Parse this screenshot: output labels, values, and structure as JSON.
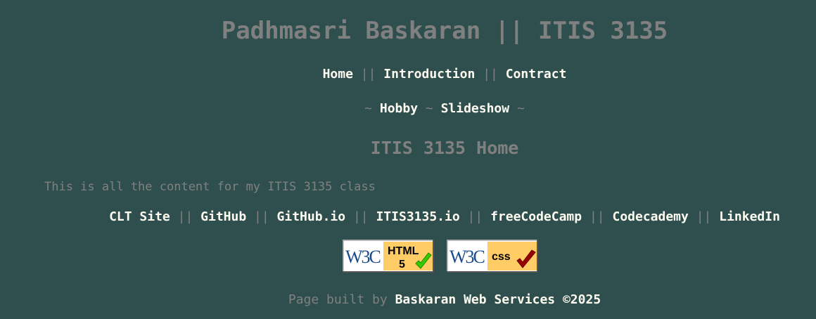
{
  "header": {
    "title": "Padhmasri Baskaran || ITIS 3135"
  },
  "nav_primary": {
    "items": [
      "Home",
      "Introduction",
      "Contract"
    ],
    "separator": "||"
  },
  "nav_secondary": {
    "items": [
      "Hobby",
      "Slideshow"
    ],
    "separator": "~"
  },
  "main": {
    "heading": "ITIS 3135 Home",
    "intro": "This is all the content for my ITIS 3135 class"
  },
  "footer": {
    "links": [
      "CLT Site",
      "GitHub",
      "GitHub.io",
      "ITIS3135.io",
      "freeCodeCamp",
      "Codecademy",
      "LinkedIn"
    ],
    "separator": "||",
    "badges": [
      {
        "brand": "W3C",
        "label": "HTML",
        "sublabel": "5",
        "icon": "green-check-icon"
      },
      {
        "brand": "W3C",
        "label": "css",
        "icon": "red-check-icon"
      }
    ],
    "built_by_prefix": "Page built by",
    "built_by_company": "Baskaran Web Services ©2025"
  },
  "colors": {
    "background": "#2f4f4f",
    "muted_text": "#808080",
    "link_text": "#fffdf2",
    "badge_blue": "#1a4c8c",
    "badge_gold": "#ffcc66",
    "check_green": "#33cc00",
    "check_red": "#990000"
  }
}
